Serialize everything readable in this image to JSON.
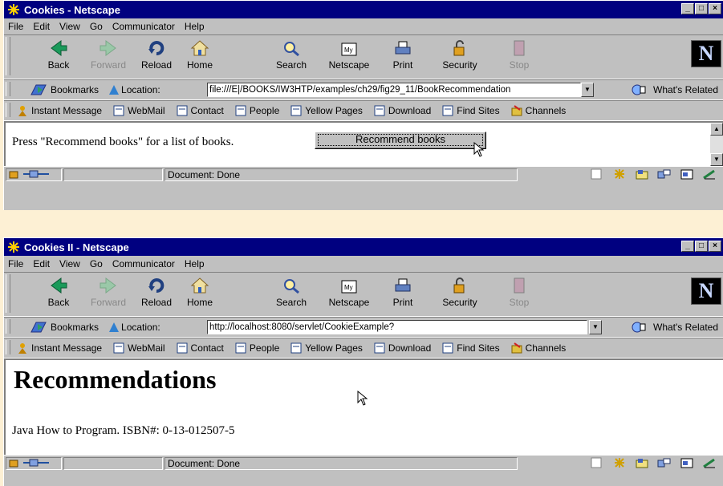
{
  "windows": [
    {
      "title": "Cookies - Netscape",
      "menu": [
        "File",
        "Edit",
        "View",
        "Go",
        "Communicator",
        "Help"
      ],
      "nav": {
        "back": "Back",
        "forward": "Forward",
        "reload": "Reload",
        "home": "Home",
        "search": "Search",
        "netscape": "Netscape",
        "print": "Print",
        "security": "Security",
        "stop": "Stop"
      },
      "bookmarks_label": "Bookmarks",
      "location_label": "Location:",
      "url": "file:///E|/BOOKS/IW3HTP/examples/ch29/fig29_11/BookRecommendation",
      "whats_related": "What's Related",
      "personal": [
        "Instant Message",
        "WebMail",
        "Contact",
        "People",
        "Yellow Pages",
        "Download",
        "Find Sites",
        "Channels"
      ],
      "page": {
        "prompt": "Press \"Recommend books\" for a list of books.",
        "button": "Recommend books"
      },
      "status": "Document: Done"
    },
    {
      "title": "Cookies II - Netscape",
      "menu": [
        "File",
        "Edit",
        "View",
        "Go",
        "Communicator",
        "Help"
      ],
      "nav": {
        "back": "Back",
        "forward": "Forward",
        "reload": "Reload",
        "home": "Home",
        "search": "Search",
        "netscape": "Netscape",
        "print": "Print",
        "security": "Security",
        "stop": "Stop"
      },
      "bookmarks_label": "Bookmarks",
      "location_label": "Location:",
      "url": "http://localhost:8080/servlet/CookieExample?",
      "whats_related": "What's Related",
      "personal": [
        "Instant Message",
        "WebMail",
        "Contact",
        "People",
        "Yellow Pages",
        "Download",
        "Find Sites",
        "Channels"
      ],
      "page": {
        "heading": "Recommendations",
        "book": "Java How to Program. ISBN#: 0-13-012507-5"
      },
      "status": "Document: Done"
    }
  ],
  "colors": {
    "titlebar": "#000080",
    "chrome": "#c0c0c0",
    "backdrop": "#fdf0d4"
  }
}
